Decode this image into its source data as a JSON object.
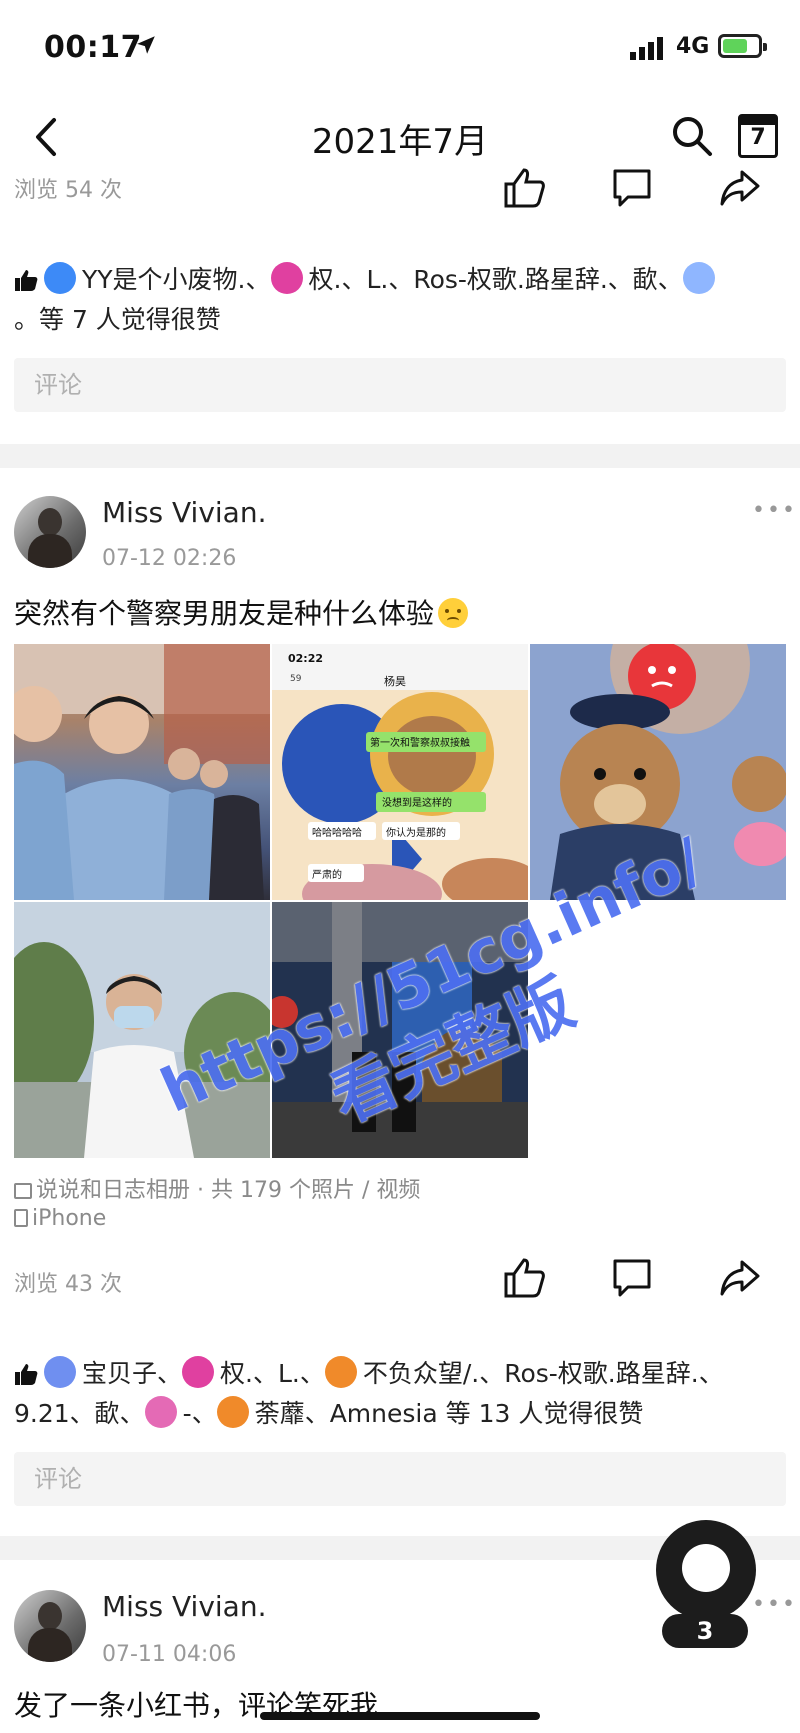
{
  "status_bar": {
    "time": "00:17",
    "network": "4G"
  },
  "navbar": {
    "title": "2021年7月",
    "calendar_day": "7"
  },
  "post_prev": {
    "views": "浏览 54 次",
    "likes": {
      "names": [
        "YY是个小废物.、",
        "权.、L.、Ros-权歌.路星辞.、歃、",
        "。等 7 人觉得很赞"
      ]
    },
    "comment_placeholder": "评论"
  },
  "post1": {
    "author": "Miss Vivian.",
    "datetime": "07-12 02:26",
    "text": "突然有个警察男朋友是种什么体验",
    "chat_screenshot": {
      "time": "02:22",
      "contact": "杨昊",
      "back_count": "59",
      "messages": [
        "第一次和警察叔叔接触",
        "没想到是这样的",
        "哈哈哈哈哈",
        "你认为是那的",
        "严肃的"
      ]
    },
    "album_info": "说说和日志相册 · 共 179 个照片 / 视频",
    "device": "iPhone",
    "views": "浏览 43 次",
    "likes": {
      "names": [
        "宝贝子、",
        "权.、L.、",
        "不负众望/.、Ros-权歌.路星辞.、",
        "9.21、歃、",
        "-、",
        "荼蘼、Amnesia 等 13 人觉得很赞"
      ]
    },
    "comment_placeholder": "评论"
  },
  "post2": {
    "author": "Miss Vivian.",
    "datetime": "07-11 04:06",
    "text": "发了一条小红书，评论笑死我"
  },
  "watermark": {
    "line1": "https://51cg.info/",
    "line2": "看完整版"
  },
  "fab": {
    "badge": "3"
  }
}
